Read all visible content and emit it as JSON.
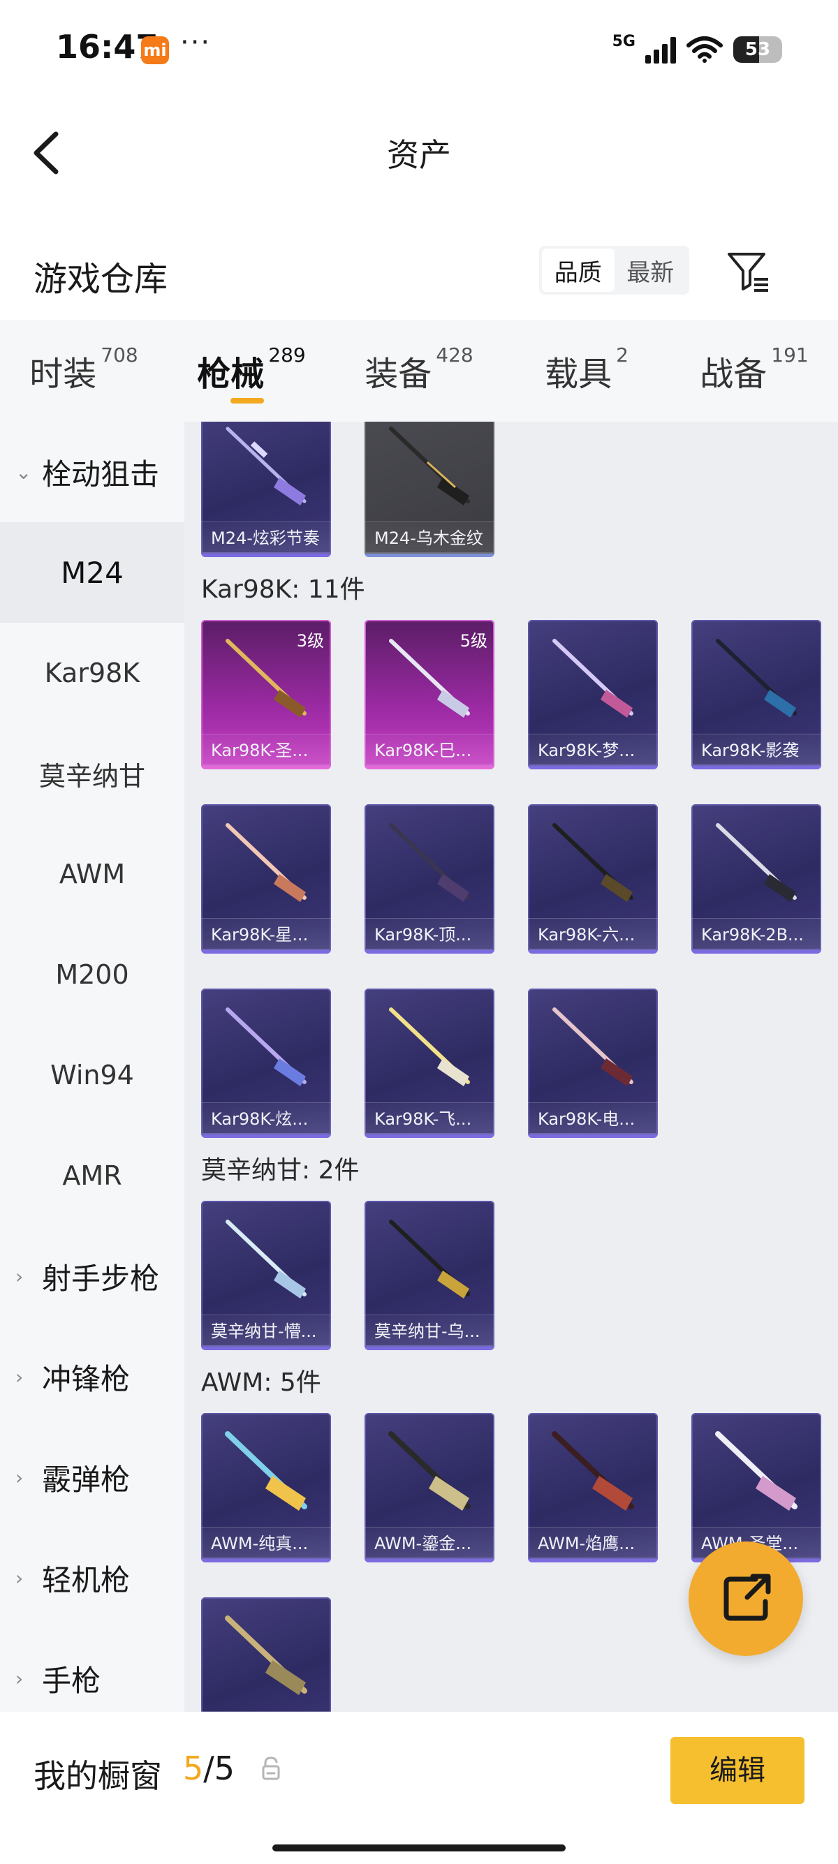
{
  "status_bar": {
    "time": "16:47",
    "app_badge": "mi",
    "more": "···",
    "network": "5G",
    "battery": "53"
  },
  "nav": {
    "title": "资产",
    "back_icon": "chevron-left-icon"
  },
  "section": {
    "title": "游戏仓库",
    "sort_options": [
      "品质",
      "最新"
    ],
    "sort_selected": "品质",
    "filter_icon": "filter-icon"
  },
  "tabs": [
    {
      "label": "时装",
      "count": "708"
    },
    {
      "label": "枪械",
      "count": "289",
      "active": true
    },
    {
      "label": "装备",
      "count": "428"
    },
    {
      "label": "载具",
      "count": "2"
    },
    {
      "label": "战备",
      "count": "191"
    }
  ],
  "sidebar": {
    "items": [
      {
        "label": "栓动狙击",
        "type": "group",
        "expanded": true
      },
      {
        "label": "M24",
        "type": "sub",
        "active": true
      },
      {
        "label": "Kar98K",
        "type": "sub"
      },
      {
        "label": "莫辛纳甘",
        "type": "sub"
      },
      {
        "label": "AWM",
        "type": "sub"
      },
      {
        "label": "M200",
        "type": "sub"
      },
      {
        "label": "Win94",
        "type": "sub"
      },
      {
        "label": "AMR",
        "type": "sub"
      },
      {
        "label": "射手步枪",
        "type": "group"
      },
      {
        "label": "冲锋枪",
        "type": "group"
      },
      {
        "label": "霰弹枪",
        "type": "group"
      },
      {
        "label": "轻机枪",
        "type": "group"
      },
      {
        "label": "手枪",
        "type": "group"
      }
    ]
  },
  "content": {
    "m24_items": [
      {
        "name": "M24-炫彩节奏",
        "rarity": "epic"
      },
      {
        "name": "M24-乌木金纹",
        "rarity": "gray"
      }
    ],
    "groups": [
      {
        "title": "Kar98K: 11件",
        "items": [
          {
            "name": "Kar98K-圣...",
            "level": "3级",
            "rarity": "legendary"
          },
          {
            "name": "Kar98K-巳...",
            "level": "5级",
            "rarity": "legendary"
          },
          {
            "name": "Kar98K-梦...",
            "rarity": "epic"
          },
          {
            "name": "Kar98K-影袭",
            "rarity": "epic"
          },
          {
            "name": "Kar98K-星...",
            "rarity": "epic"
          },
          {
            "name": "Kar98K-顶...",
            "rarity": "epic"
          },
          {
            "name": "Kar98K-六...",
            "rarity": "epic"
          },
          {
            "name": "Kar98K-2B...",
            "rarity": "epic"
          },
          {
            "name": "Kar98K-炫...",
            "rarity": "epic"
          },
          {
            "name": "Kar98K-飞...",
            "rarity": "epic"
          },
          {
            "name": "Kar98K-电...",
            "rarity": "epic"
          }
        ]
      },
      {
        "title": "莫辛纳甘: 2件",
        "items": [
          {
            "name": "莫辛纳甘-懵...",
            "rarity": "epic"
          },
          {
            "name": "莫辛纳甘-乌...",
            "rarity": "epic"
          }
        ]
      },
      {
        "title": "AWM: 5件",
        "items": [
          {
            "name": "AWM-纯真...",
            "rarity": "epic"
          },
          {
            "name": "AWM-鎏金...",
            "rarity": "epic"
          },
          {
            "name": "AWM-焰鹰...",
            "rarity": "epic"
          },
          {
            "name": "AWM-圣堂...",
            "rarity": "epic"
          },
          {
            "name": "",
            "rarity": "epic"
          }
        ]
      }
    ]
  },
  "fab": {
    "icon": "share-external-icon",
    "color": "#f2ab2f"
  },
  "bottom_bar": {
    "label": "我的橱窗",
    "current": "5",
    "total": "/5",
    "lock_icon": "lock-icon",
    "edit_label": "编辑"
  },
  "colors": {
    "accent": "#f2a91f",
    "epic": "#2e2a62",
    "legendary": "#9b2aa3"
  }
}
